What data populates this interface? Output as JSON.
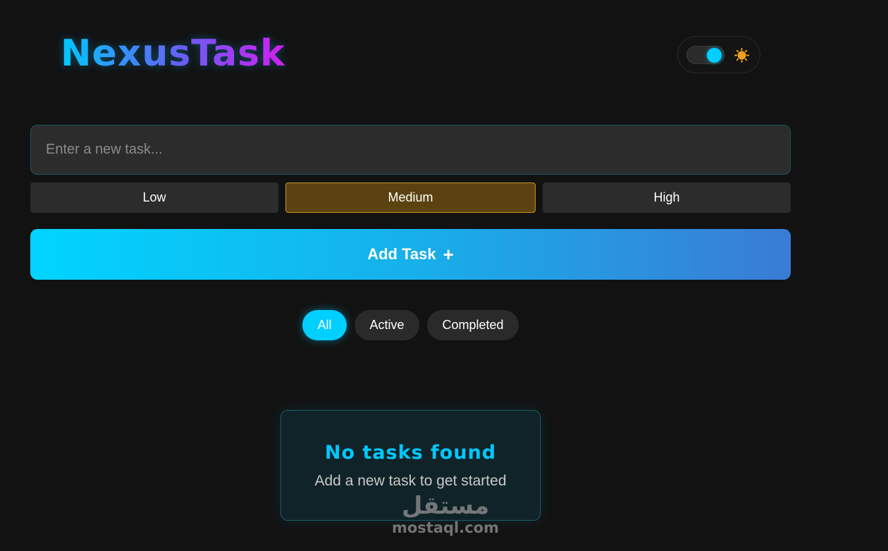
{
  "app": {
    "title": "NexusTask"
  },
  "theme_toggle": {
    "state": "dark",
    "knob_color": "#00cfff",
    "icon": "sun-icon",
    "icon_color": "#f0a020"
  },
  "task_input": {
    "placeholder": "Enter a new task...",
    "value": ""
  },
  "priority": {
    "options": [
      "Low",
      "Medium",
      "High"
    ],
    "selected": "Medium",
    "selected_color": "#c9951e"
  },
  "add_button": {
    "label": "Add Task",
    "icon": "plus-icon"
  },
  "filters": {
    "options": [
      "All",
      "Active",
      "Completed"
    ],
    "selected": "All",
    "accent": "#00cfff"
  },
  "empty_state": {
    "title": "No tasks found",
    "subtitle": "Add a new task to get started"
  },
  "watermark": {
    "arabic": "مستقل",
    "latin": "mostaql.com"
  }
}
